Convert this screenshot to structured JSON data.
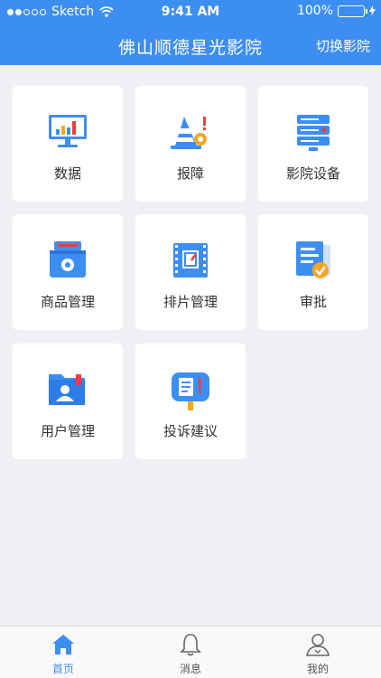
{
  "status_bar": {
    "carrier": "Sketch",
    "time": "9:41 AM",
    "battery": "100%",
    "battery_level": 1.0
  },
  "header": {
    "title": "佛山顺德星光影院",
    "switch_label": "切换影院"
  },
  "tiles": [
    {
      "label": "数据",
      "icon": "data-chart-icon"
    },
    {
      "label": "报障",
      "icon": "fault-report-icon"
    },
    {
      "label": "影院设备",
      "icon": "cinema-equipment-icon"
    },
    {
      "label": "商品管理",
      "icon": "goods-management-icon"
    },
    {
      "label": "排片管理",
      "icon": "schedule-management-icon"
    },
    {
      "label": "审批",
      "icon": "approval-icon"
    },
    {
      "label": "用户管理",
      "icon": "user-management-icon"
    },
    {
      "label": "投诉建议",
      "icon": "complaint-suggestion-icon"
    }
  ],
  "tabbar": {
    "items": [
      {
        "label": "首页",
        "icon": "home-icon",
        "active": true
      },
      {
        "label": "消息",
        "icon": "bell-icon",
        "active": false
      },
      {
        "label": "我的",
        "icon": "profile-icon",
        "active": false
      }
    ]
  },
  "colors": {
    "primary": "#3d8ef2",
    "accent_orange": "#f5a623",
    "alert_red": "#e8413c",
    "background": "#efeff4"
  }
}
